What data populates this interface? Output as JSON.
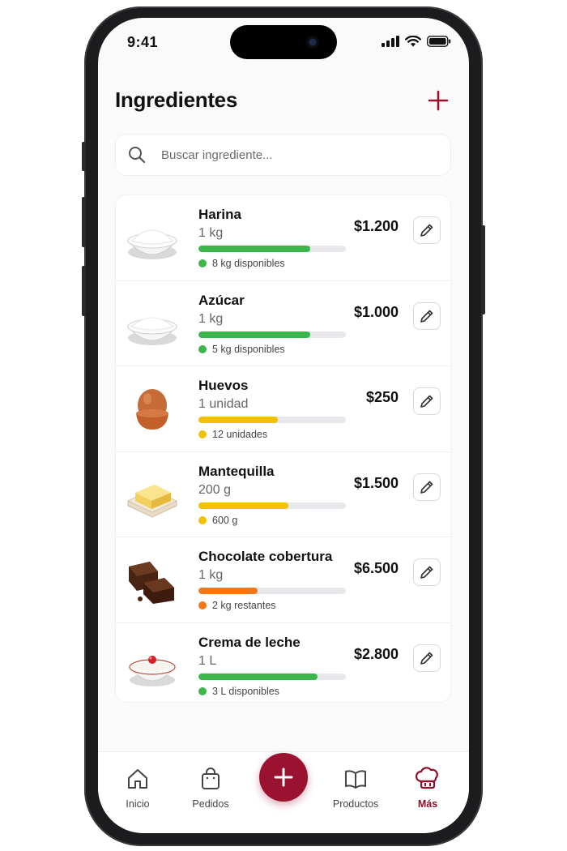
{
  "status": {
    "time": "9:41"
  },
  "header": {
    "title": "Ingredientes"
  },
  "search": {
    "placeholder": "Buscar ingrediente..."
  },
  "colors": {
    "accent": "#9b1230",
    "green": "#3cb64b",
    "yellow": "#f2c200",
    "orange": "#f07818"
  },
  "ingredients": [
    {
      "name": "Harina",
      "unit": "1 kg",
      "price": "$1.200",
      "stock": "8 kg disponibles",
      "level": 0.76,
      "status": "green",
      "icon": "flour-bowl-image"
    },
    {
      "name": "Azúcar",
      "unit": "1 kg",
      "price": "$1.000",
      "stock": "5 kg disponibles",
      "level": 0.76,
      "status": "green",
      "icon": "sugar-bowl-image"
    },
    {
      "name": "Huevos",
      "unit": "1 unidad",
      "price": "$250",
      "stock": "12 unidades",
      "level": 0.54,
      "status": "yellow",
      "icon": "egg-image"
    },
    {
      "name": "Mantequilla",
      "unit": "200 g",
      "price": "$1.500",
      "stock": "600 g",
      "level": 0.61,
      "status": "yellow",
      "icon": "butter-image"
    },
    {
      "name": "Chocolate cobertura",
      "unit": "1 kg",
      "price": "$6.500",
      "stock": "2 kg restantes",
      "level": 0.4,
      "status": "orange",
      "icon": "chocolate-image"
    },
    {
      "name": "Crema de leche",
      "unit": "1 L",
      "price": "$2.800",
      "stock": "3 L disponibles",
      "level": 0.81,
      "status": "green",
      "icon": "cream-bowl-image"
    }
  ],
  "tabbar": {
    "items": [
      {
        "label": "Inicio",
        "icon": "home-icon"
      },
      {
        "label": "Pedidos",
        "icon": "shopping-bag-icon"
      },
      {
        "label": "Productos",
        "icon": "book-icon"
      },
      {
        "label": "Más",
        "icon": "chef-hat-icon",
        "active": true
      }
    ]
  }
}
